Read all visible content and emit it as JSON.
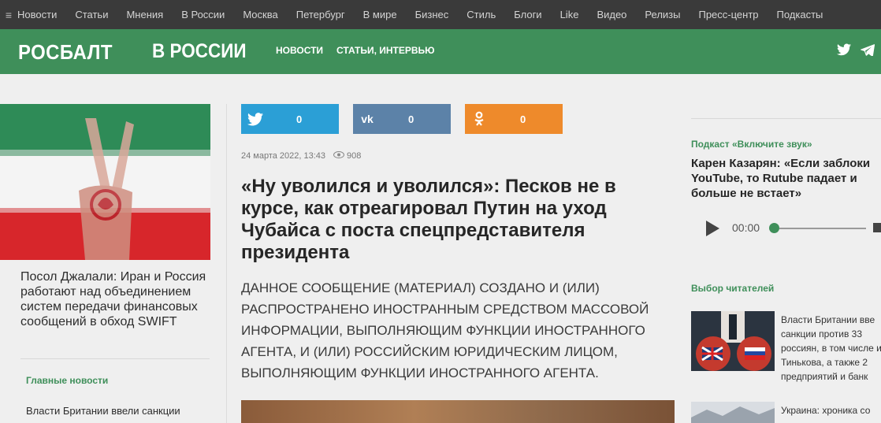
{
  "topnav": {
    "items": [
      "Новости",
      "Статьи",
      "Мнения",
      "В России",
      "Москва",
      "Петербург",
      "В мире",
      "Бизнес",
      "Стиль",
      "Блоги",
      "Like",
      "Видео",
      "Релизы",
      "Пресс-центр",
      "Подкасты"
    ]
  },
  "header": {
    "logo": "РОСБАЛТ",
    "section": "В РОССИИ",
    "nav": [
      "НОВОСТИ",
      "СТАТЬИ, ИНТЕРВЬЮ"
    ]
  },
  "left": {
    "caption": "Посол Джалали: Иран и Россия работают над объединением систем передачи финансовых сообщений в обход SWIFT",
    "heading": "Главные новости",
    "news": "Власти Британии ввели санкции"
  },
  "share": {
    "twitter_count": "0",
    "vk_count": "0",
    "ok_count": "0"
  },
  "article": {
    "date": "24 марта 2022, 13:43",
    "views": "908",
    "headline": "«Ну уволился и уволился»: Песков не в курсе, как отреагировал Путин на уход Чубайса с поста спецпредставителя президента",
    "disclaimer": "ДАННОЕ СООБЩЕНИЕ (МАТЕРИАЛ) СОЗДАНО И (ИЛИ) РАСПРОСТРАНЕНО ИНОСТРАННЫМ СРЕДСТВОМ МАССОВОЙ ИНФОРМАЦИИ, ВЫПОЛНЯЮЩИМ ФУНКЦИИ ИНОСТРАННОГО АГЕНТА, И (ИЛИ) РОССИЙСКИМ ЮРИДИЧЕСКИМ ЛИЦОМ, ВЫПОЛНЯЮЩИМ ФУНКЦИИ ИНОСТРАННОГО АГЕНТА."
  },
  "right": {
    "podcast_label": "Подкаст «Включите звук»",
    "podcast_title": "Карен Казарян: «Если заблоки YouTube, то Rutube падает и больше не встает»",
    "player_time": "00:00",
    "readers_label": "Выбор читателей",
    "readers": [
      "Власти Британии вве санкции против 33 россиян, в том числе и Тинькова, а также 2 предприятий и банк",
      "Украина: хроника со"
    ]
  },
  "colors": {
    "brand_green": "#3f8f5a",
    "twitter": "#2b9fd6",
    "vk": "#5c82a8",
    "ok": "#ee8a2b"
  }
}
